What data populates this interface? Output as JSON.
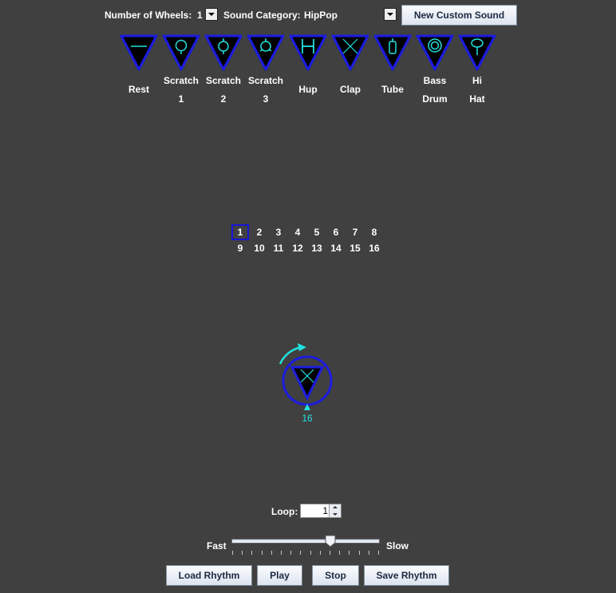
{
  "toolbar": {
    "wheels_label": "Number of Wheels:",
    "wheels_value": "1",
    "category_label": "Sound Category:",
    "category_value": "HipPop",
    "new_custom_label": "New Custom Sound"
  },
  "sounds": [
    {
      "line1": "Rest",
      "line2": "",
      "icon": "rest-symbol"
    },
    {
      "line1": "Scratch",
      "line2": "1",
      "icon": "scratch1-symbol"
    },
    {
      "line1": "Scratch",
      "line2": "2",
      "icon": "scratch2-symbol"
    },
    {
      "line1": "Scratch",
      "line2": "3",
      "icon": "scratch3-symbol"
    },
    {
      "line1": "Hup",
      "line2": "",
      "icon": "hup-symbol"
    },
    {
      "line1": "Clap",
      "line2": "",
      "icon": "clap-symbol"
    },
    {
      "line1": "Tube",
      "line2": "",
      "icon": "tube-symbol"
    },
    {
      "line1": "Bass",
      "line2": "Drum",
      "icon": "bass-drum-symbol"
    },
    {
      "line1": "Hi",
      "line2": "Hat",
      "icon": "hi-hat-symbol"
    }
  ],
  "beats": {
    "row1": [
      "1",
      "2",
      "3",
      "4",
      "5",
      "6",
      "7",
      "8"
    ],
    "row2": [
      "9",
      "10",
      "11",
      "12",
      "13",
      "14",
      "15",
      "16"
    ],
    "selected": "1"
  },
  "wheel": {
    "count_label": "16",
    "current_symbol": "clap-symbol"
  },
  "loop": {
    "label": "Loop:",
    "value": "1"
  },
  "tempo": {
    "fast_label": "Fast",
    "slow_label": "Slow",
    "value_fraction": 0.67
  },
  "buttons": {
    "load": "Load Rhythm",
    "play": "Play",
    "stop": "Stop",
    "save": "Save Rhythm"
  },
  "colors": {
    "background": "#404040",
    "symbol_outline": "#1c1ce0",
    "symbol_glyph": "#22e0e0",
    "selection": "#1616d8"
  }
}
